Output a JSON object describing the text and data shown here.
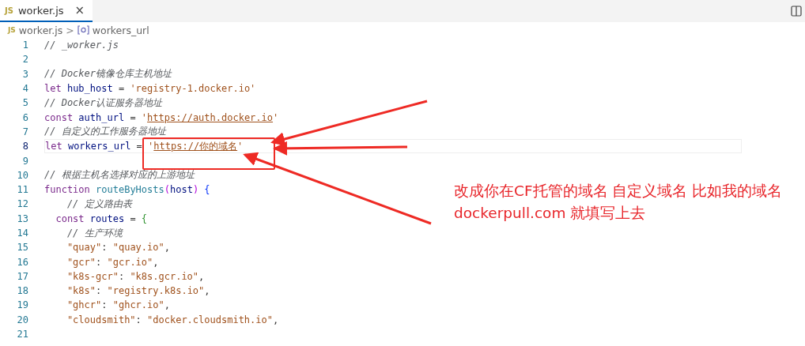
{
  "tabs": [
    {
      "label": "worker.js",
      "icon": "JS",
      "selected": true,
      "close": "×"
    }
  ],
  "breadcrumb": {
    "file_icon": "JS",
    "file": "worker.js",
    "separator": ">",
    "symbol": "workers_url"
  },
  "lines": [
    {
      "number": "1",
      "current": false,
      "tokens": [
        {
          "kind": "comment",
          "text": "// _worker.js"
        }
      ]
    },
    {
      "number": "2",
      "current": false
    },
    {
      "number": "3",
      "current": false,
      "tokens": [
        {
          "kind": "comment",
          "text": "// Docker镜像仓库主机地址"
        }
      ]
    },
    {
      "number": "4",
      "current": false,
      "tokens": [
        {
          "kind": "keyword",
          "text": "let "
        },
        {
          "kind": "variable",
          "text": "hub_host"
        },
        {
          "kind": "plain",
          "text": " = "
        },
        {
          "kind": "string",
          "text": "'registry-1.docker.io'"
        }
      ]
    },
    {
      "number": "5",
      "current": false,
      "tokens": [
        {
          "kind": "comment",
          "text": "// Docker认证服务器地址"
        }
      ]
    },
    {
      "number": "6",
      "current": false,
      "tokens": [
        {
          "kind": "keyword",
          "text": "const "
        },
        {
          "kind": "variable",
          "text": "auth_url"
        },
        {
          "kind": "plain",
          "text": " = "
        },
        {
          "kind": "string",
          "text": "'"
        },
        {
          "kind": "link",
          "text": "https://auth.docker.io"
        },
        {
          "kind": "string",
          "text": "'"
        }
      ]
    },
    {
      "number": "7",
      "current": false,
      "tokens": [
        {
          "kind": "comment",
          "text": "// 自定义的工作服务器地址"
        }
      ]
    },
    {
      "number": "8",
      "current": true,
      "tokens": [
        {
          "kind": "keyword",
          "text": "let "
        },
        {
          "kind": "variable",
          "text": "workers_url"
        },
        {
          "kind": "plain",
          "text": " = "
        },
        {
          "kind": "string",
          "text": "'"
        },
        {
          "kind": "link",
          "text": "https://你的域名"
        },
        {
          "kind": "string",
          "text": "'"
        }
      ]
    },
    {
      "number": "9",
      "current": false
    },
    {
      "number": "10",
      "current": false,
      "tokens": [
        {
          "kind": "comment",
          "text": "// 根据主机名选择对应的上游地址"
        }
      ]
    },
    {
      "number": "11",
      "current": false,
      "tokens": [
        {
          "kind": "keyword",
          "text": "function "
        },
        {
          "kind": "function",
          "text": "routeByHosts"
        },
        {
          "kind": "paren",
          "text": "("
        },
        {
          "kind": "variable",
          "text": "host"
        },
        {
          "kind": "paren",
          "text": ") "
        },
        {
          "kind": "brace",
          "text": "{"
        }
      ]
    },
    {
      "number": "12",
      "current": false,
      "tokens": [
        {
          "kind": "comment",
          "text": "    // 定义路由表"
        }
      ]
    },
    {
      "number": "13",
      "current": false,
      "tokens": [
        {
          "kind": "keyword",
          "text": "  const "
        },
        {
          "kind": "variable",
          "text": "routes"
        },
        {
          "kind": "plain",
          "text": " = "
        },
        {
          "kind": "brace2",
          "text": "{"
        }
      ]
    },
    {
      "number": "14",
      "current": false,
      "tokens": [
        {
          "kind": "comment",
          "text": "    // 生产环境"
        }
      ]
    },
    {
      "number": "15",
      "current": false,
      "tokens": [
        {
          "kind": "string",
          "text": "    \"quay\""
        },
        {
          "kind": "plain",
          "text": ": "
        },
        {
          "kind": "string",
          "text": "\"quay.io\""
        },
        {
          "kind": "plain",
          "text": ","
        }
      ]
    },
    {
      "number": "16",
      "current": false,
      "tokens": [
        {
          "kind": "string",
          "text": "    \"gcr\""
        },
        {
          "kind": "plain",
          "text": ": "
        },
        {
          "kind": "string",
          "text": "\"gcr.io\""
        },
        {
          "kind": "plain",
          "text": ","
        }
      ]
    },
    {
      "number": "17",
      "current": false,
      "tokens": [
        {
          "kind": "string",
          "text": "    \"k8s-gcr\""
        },
        {
          "kind": "plain",
          "text": ": "
        },
        {
          "kind": "string",
          "text": "\"k8s.gcr.io\""
        },
        {
          "kind": "plain",
          "text": ","
        }
      ]
    },
    {
      "number": "18",
      "current": false,
      "tokens": [
        {
          "kind": "string",
          "text": "    \"k8s\""
        },
        {
          "kind": "plain",
          "text": ": "
        },
        {
          "kind": "string",
          "text": "\"registry.k8s.io\""
        },
        {
          "kind": "plain",
          "text": ","
        }
      ]
    },
    {
      "number": "19",
      "current": false,
      "tokens": [
        {
          "kind": "string",
          "text": "    \"ghcr\""
        },
        {
          "kind": "plain",
          "text": ": "
        },
        {
          "kind": "string",
          "text": "\"ghcr.io\""
        },
        {
          "kind": "plain",
          "text": ","
        }
      ]
    },
    {
      "number": "20",
      "current": false,
      "tokens": [
        {
          "kind": "string",
          "text": "    \"cloudsmith\""
        },
        {
          "kind": "plain",
          "text": ": "
        },
        {
          "kind": "string",
          "text": "\"docker.cloudsmith.io\""
        },
        {
          "kind": "plain",
          "text": ","
        }
      ]
    },
    {
      "number": "21",
      "current": false
    }
  ],
  "annotation": {
    "text": "改成你在CF托管的域名 自定义域名 比如我的域名dockerpull.com 就填写上去"
  }
}
